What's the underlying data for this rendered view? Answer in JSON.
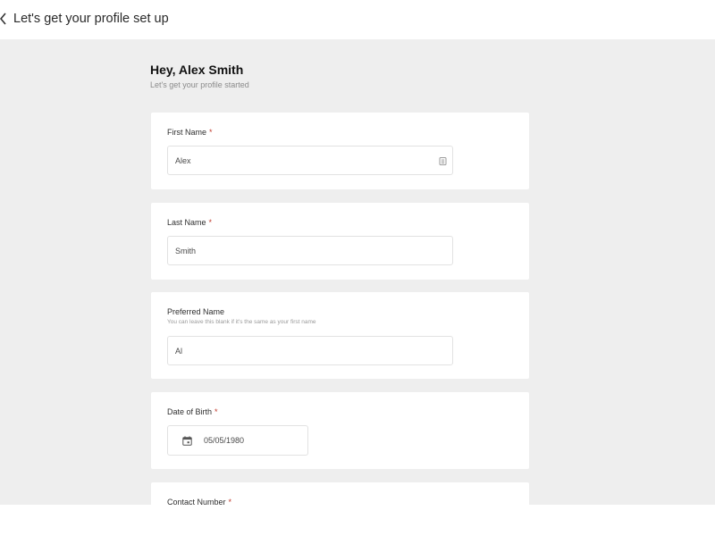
{
  "header": {
    "title": "Let's get your profile set up"
  },
  "greeting": {
    "title": "Hey, Alex Smith",
    "subtitle": "Let's get your profile started"
  },
  "form": {
    "first_name": {
      "label": "First Name",
      "required_mark": "*",
      "value": "Alex"
    },
    "last_name": {
      "label": "Last Name",
      "required_mark": "*",
      "value": "Smith"
    },
    "preferred_name": {
      "label": "Preferred Name",
      "help": "You can leave this blank if it's the same as your first name",
      "value": "Al"
    },
    "date_of_birth": {
      "label": "Date of Birth",
      "required_mark": "*",
      "value": "05/05/1980"
    },
    "contact_number": {
      "label": "Contact Number",
      "required_mark": "*"
    }
  },
  "icons": {
    "back": "chevron-left-icon",
    "autofill": "contact-card-icon",
    "calendar": "calendar-icon"
  },
  "colors": {
    "background": "#eeeeee",
    "card": "#ffffff",
    "required": "#c0392b"
  }
}
